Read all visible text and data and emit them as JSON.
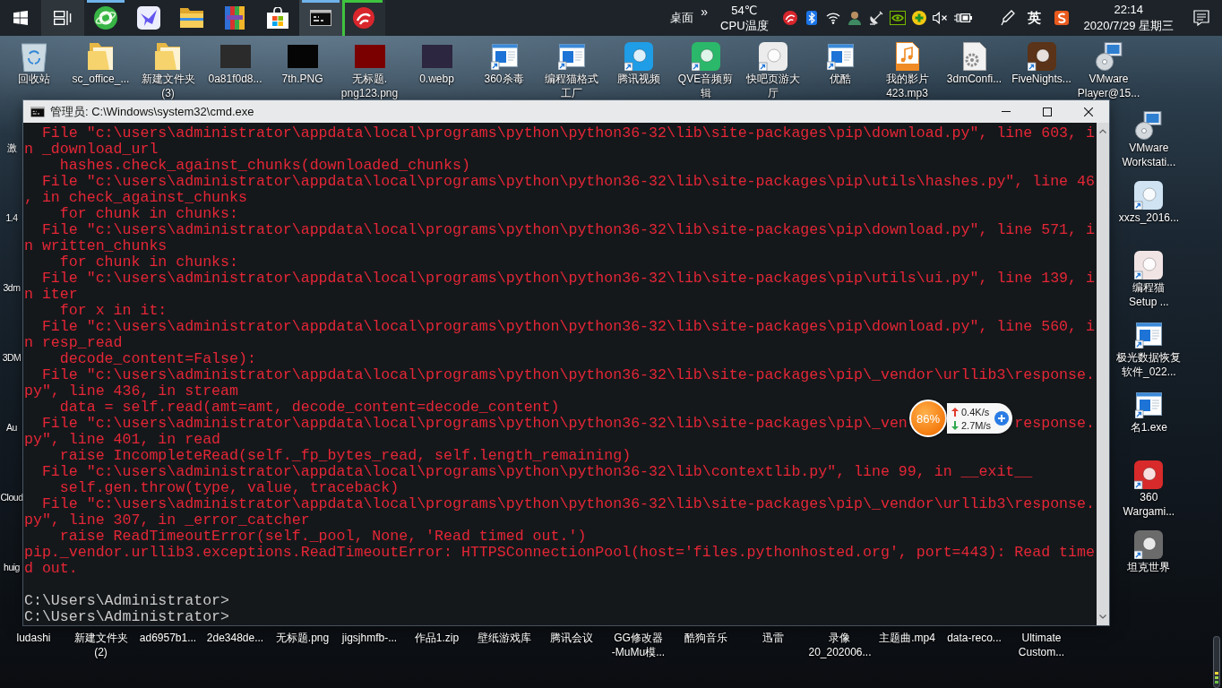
{
  "taskbar": {
    "task_view": {
      "highlighted": true
    },
    "apps": [
      {
        "running": true,
        "focused": false,
        "progress": false
      },
      {
        "running": false,
        "focused": false,
        "progress": false
      },
      {
        "running": false,
        "focused": false,
        "progress": false
      },
      {
        "running": false,
        "focused": false,
        "progress": false
      },
      {
        "running": false,
        "focused": false,
        "progress": false
      },
      {
        "running": true,
        "focused": true,
        "progress": false
      },
      {
        "running": true,
        "focused": false,
        "progress": true
      }
    ],
    "toolbar": {
      "label": "桌面",
      "chevron": "»"
    },
    "cpu": {
      "temperature": "54℃",
      "label": "CPU温度"
    },
    "ime": "英",
    "clock": {
      "time": "22:14",
      "date": "2020/7/29 星期三"
    }
  },
  "desktop": {
    "top_row": [
      {
        "label": "回收站",
        "kind": "bin"
      },
      {
        "label": "sc_office_...",
        "kind": "folder"
      },
      {
        "label": "新建文件夹\n(3)",
        "kind": "folder"
      },
      {
        "label": "0a81f0d8...",
        "kind": "photo",
        "color": "#2b2b2b"
      },
      {
        "label": "7th.PNG",
        "kind": "photo",
        "color": "#050505"
      },
      {
        "label": "无标题.\npng123.png",
        "kind": "photo",
        "color": "#7a0000"
      },
      {
        "label": "0.webp",
        "kind": "photo",
        "color": "#2c2640"
      },
      {
        "label": "360杀毒",
        "kind": "shortcut"
      },
      {
        "label": "编程猫格式工厂",
        "kind": "shortcut"
      },
      {
        "label": "腾讯视频",
        "kind": "app",
        "color": "#1f9de6"
      },
      {
        "label": "QVE音频剪辑",
        "kind": "app",
        "color": "#2bb86a"
      },
      {
        "label": "快吧页游大厅",
        "kind": "app",
        "color": "#ececec"
      },
      {
        "label": "优酷",
        "kind": "shortcut"
      },
      {
        "label": "我的影片\n423.mp3",
        "kind": "audio"
      },
      {
        "label": "3dmConfi...",
        "kind": "config"
      },
      {
        "label": "FiveNights...",
        "kind": "app",
        "color": "#5a3318"
      },
      {
        "label": "VMware\nPlayer@15...",
        "kind": "installer"
      }
    ],
    "left_column": [
      "激",
      "1.4",
      "3dm",
      "3DM",
      "Au",
      "Cloud",
      "huig"
    ],
    "right_column": [
      {
        "label": "VMware\nWorkstati...",
        "kind": "installer"
      },
      {
        "label": "xxzs_2016...",
        "kind": "app",
        "color": "#cfe3f2"
      },
      {
        "label": "编程猫\nSetup ...",
        "kind": "app",
        "color": "#f1e4e4"
      },
      {
        "label": "极光数据恢复软件_022...",
        "kind": "shortcut"
      },
      {
        "label": "名1.exe",
        "kind": "shortcut"
      },
      {
        "label": "360\nWargami...",
        "kind": "app",
        "color": "#d82a2a"
      },
      {
        "label": "坦克世界",
        "kind": "app",
        "color": "#6b6b6b"
      }
    ],
    "bottom_row": [
      "ludashi",
      "新建文件夹\n(2)",
      "ad6957b1...",
      "2de348de...",
      "无标题.png",
      "jigsjhmfb-...",
      "作品1.zip",
      "壁纸游戏库",
      "腾讯会议",
      "GG修改器\n-MuMu模...",
      "酷狗音乐",
      "迅雷",
      "录像\n20_202006...",
      "主题曲.mp4",
      "data-reco...",
      "Ultimate\nCustom..."
    ]
  },
  "cmd_window": {
    "title": "管理员: C:\\Windows\\system32\\cmd.exe",
    "traceback": [
      {
        "text": "  File \"c:\\users\\administrator\\appdata\\local\\programs\\python\\python36-32\\lib\\site-packages\\pip\\download.py\", line 603, i"
      },
      {
        "text": "n _download_url"
      },
      {
        "text": "    hashes.check_against_chunks(downloaded_chunks)"
      },
      {
        "text": "  File \"c:\\users\\administrator\\appdata\\local\\programs\\python\\python36-32\\lib\\site-packages\\pip\\utils\\hashes.py\", line 46"
      },
      {
        "text": ", in check_against_chunks"
      },
      {
        "text": "    for chunk in chunks:"
      },
      {
        "text": "  File \"c:\\users\\administrator\\appdata\\local\\programs\\python\\python36-32\\lib\\site-packages\\pip\\download.py\", line 571, i"
      },
      {
        "text": "n written_chunks"
      },
      {
        "text": "    for chunk in chunks:"
      },
      {
        "text": "  File \"c:\\users\\administrator\\appdata\\local\\programs\\python\\python36-32\\lib\\site-packages\\pip\\utils\\ui.py\", line 139, i"
      },
      {
        "text": "n iter"
      },
      {
        "text": "    for x in it:"
      },
      {
        "text": "  File \"c:\\users\\administrator\\appdata\\local\\programs\\python\\python36-32\\lib\\site-packages\\pip\\download.py\", line 560, i"
      },
      {
        "text": "n resp_read"
      },
      {
        "text": "    decode_content=False):"
      },
      {
        "text": "  File \"c:\\users\\administrator\\appdata\\local\\programs\\python\\python36-32\\lib\\site-packages\\pip\\_vendor\\urllib3\\response."
      },
      {
        "text": "py\", line 436, in stream"
      },
      {
        "text": "    data = self.read(amt=amt, decode_content=decode_content)"
      },
      {
        "text": "  File \"c:\\users\\administrator\\appdata\\local\\programs\\python\\python36-32\\lib\\site-packages\\pip\\_ven",
        "tail": "response."
      },
      {
        "text": "py\", line 401, in read"
      },
      {
        "text": "    raise IncompleteRead(self._fp_bytes_read, self.length_remaining)"
      },
      {
        "text": "  File \"c:\\users\\administrator\\appdata\\local\\programs\\python\\python36-32\\lib\\contextlib.py\", line 99, in __exit__"
      },
      {
        "text": "    self.gen.throw(type, value, traceback)"
      },
      {
        "text": "  File \"c:\\users\\administrator\\appdata\\local\\programs\\python\\python36-32\\lib\\site-packages\\pip\\_vendor\\urllib3\\response."
      },
      {
        "text": "py\", line 307, in _error_catcher"
      },
      {
        "text": "    raise ReadTimeoutError(self._pool, None, 'Read timed out.')"
      },
      {
        "text": "pip._vendor.urllib3.exceptions.ReadTimeoutError: HTTPSConnectionPool(host='files.pythonhosted.org', port=443): Read time"
      },
      {
        "text": "d out."
      }
    ],
    "prompts": [
      "C:\\Users\\Administrator>",
      "C:\\Users\\Administrator>"
    ]
  },
  "net_monitor": {
    "usage": "86%",
    "upload": "0.4K/s",
    "download": "2.7M/s"
  }
}
